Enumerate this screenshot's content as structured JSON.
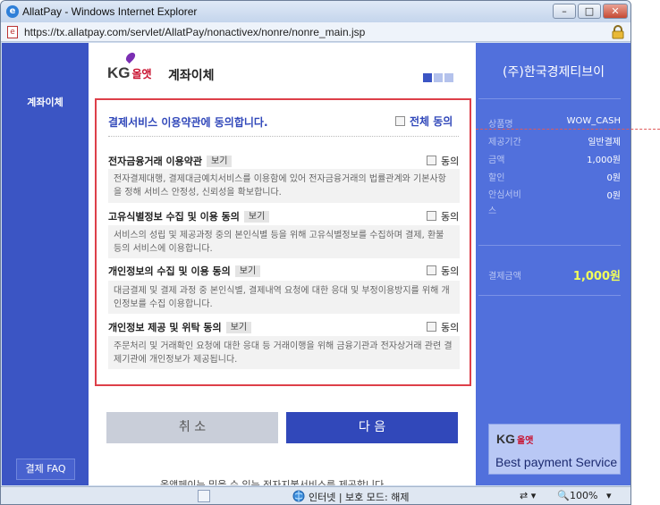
{
  "window": {
    "title": "AllatPay - Windows Internet Explorer",
    "min": "–",
    "max": "□",
    "close": "✕"
  },
  "address": {
    "url": "https://tx.allatpay.com/servlet/AllatPay/nonactivex/nonre/nonre_main.jsp"
  },
  "leftnav": {
    "menu_label": "계좌이체",
    "faq_label": "결제 FAQ"
  },
  "header": {
    "logo_kg": "KG",
    "logo_olat": "올앳",
    "page_title": "계좌이체"
  },
  "consent": {
    "heading": "결제서비스 이용약관에 동의합니다.",
    "agree_all_label": "전체 동의",
    "terms": [
      {
        "title": "전자금융거래 이용약관",
        "view_label": "보기",
        "agree_label": "동의",
        "body": "전자결제대행, 결제대금예치서비스를 이용함에 있어 전자금융거래의 법률관계와 기본사항을 정해 서비스 안정성, 신뢰성을 확보합니다."
      },
      {
        "title": "고유식별정보 수집 및 이용 동의",
        "view_label": "보기",
        "agree_label": "동의",
        "body": "서비스의 성립 및 제공과정 중의 본인식별 등을 위해 고유식별정보를 수집하며 결제, 환불 등의 서비스에 이용합니다."
      },
      {
        "title": "개인정보의 수집 및 이용 동의",
        "view_label": "보기",
        "agree_label": "동의",
        "body": "대금결제 및 결제 과정 중 본인식별, 결제내역 요청에 대한 응대 및 부정이용방지를 위해 개인정보를 수집 이용합니다."
      },
      {
        "title": "개인정보 제공 및 위탁 동의",
        "view_label": "보기",
        "agree_label": "동의",
        "body": "주문처리 및 거래확인 요청에 대한 응대 등 거래이행을 위해 금융기관과 전자상거래 관련 결제기관에 개인정보가 제공됩니다."
      }
    ]
  },
  "buttons": {
    "cancel": "취 소",
    "next": "다 음"
  },
  "footnote": "올앳페이는 믿을 수 있는 전자지불서비스를 제공합니다.",
  "order": {
    "merchant": "(주)한국경제티브이",
    "rows": [
      {
        "label": "상품명",
        "value": "WOW_CASH"
      },
      {
        "label": "제공기간",
        "value": "일반결제"
      },
      {
        "label": "금액",
        "value": "1,000원"
      },
      {
        "label": "할인",
        "value": "0원"
      },
      {
        "label": "안심서비스",
        "value": "0원"
      }
    ],
    "total_label": "결제금액",
    "total_value": "1,000원",
    "brand_kg": "KG",
    "brand_olat": "올앳",
    "brand_tagline": "Best payment Service"
  },
  "status": {
    "zone": "인터넷 | 보호 모드: 해제",
    "zoom": "100%"
  },
  "colors": {
    "brand_blue": "#3148ba",
    "panel_blue": "#5170dc",
    "consent_border": "#dd3f49",
    "total_yellow": "#f2ff5a"
  }
}
